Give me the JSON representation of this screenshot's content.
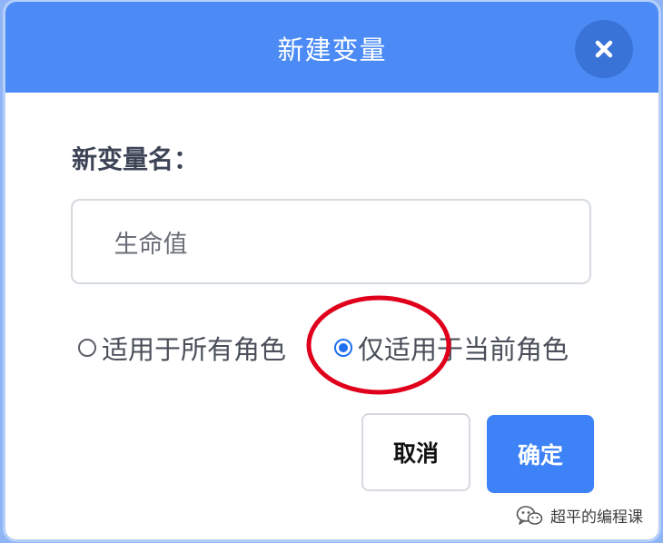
{
  "dialog": {
    "title": "新建变量",
    "close_icon": "close-icon",
    "field_label": "新变量名：",
    "input_value": "_生命值",
    "scope_options": [
      {
        "label": "适用于所有角色",
        "checked": false
      },
      {
        "label": "仅适用于当前角色",
        "checked": true
      }
    ],
    "cancel_label": "取消",
    "ok_label": "确定"
  },
  "watermark": {
    "icon": "wechat-icon",
    "text": "超平的编程课"
  },
  "colors": {
    "header": "#4c8bf5",
    "close_bg": "#3a73d8",
    "primary_button": "#3d82f6",
    "annotation_circle": "#e0001b"
  }
}
